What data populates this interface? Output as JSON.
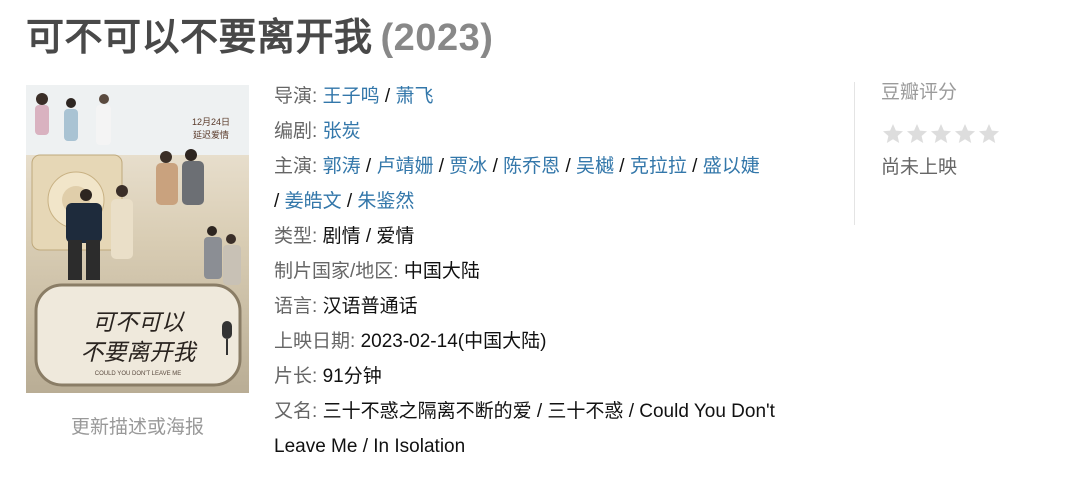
{
  "title": {
    "name": "可不可以不要离开我",
    "year": "(2023)"
  },
  "poster": {
    "alt": "可不可以不要离开我 poster",
    "release_tag_line1": "12月24日",
    "release_tag_line2": "延迟爱情",
    "calligraphy_line1": "可不可以",
    "calligraphy_line2": "不要离开我",
    "subtitle": "COULD YOU DON'T LEAVE ME",
    "update_link": "更新描述或海报"
  },
  "info": {
    "director_label": "导演",
    "directors": [
      "王子鸣",
      "萧飞"
    ],
    "writer_label": "编剧",
    "writers": [
      "张炭"
    ],
    "cast_label": "主演",
    "cast": [
      "郭涛",
      "卢靖姗",
      "贾冰",
      "陈乔恩",
      "吴樾",
      "克拉拉",
      "盛以婕",
      "姜皓文",
      "朱鉴然"
    ],
    "genre_label": "类型",
    "genres": "剧情 / 爱情",
    "country_label": "制片国家/地区",
    "country": "中国大陆",
    "language_label": "语言",
    "language": "汉语普通话",
    "release_label": "上映日期",
    "release": "2023-02-14(中国大陆)",
    "runtime_label": "片长",
    "runtime": "91分钟",
    "aka_label": "又名",
    "aka": "三十不惑之隔离不断的爱 / 三十不惑 / Could You Don't Leave Me / In Isolation"
  },
  "rating": {
    "title": "豆瓣评分",
    "stars_filled": 0,
    "stars_total": 5,
    "status": "尚未上映"
  },
  "colors": {
    "link": "#3377aa",
    "title": "#494949",
    "muted": "#999999",
    "star_empty": "#dddddd"
  }
}
